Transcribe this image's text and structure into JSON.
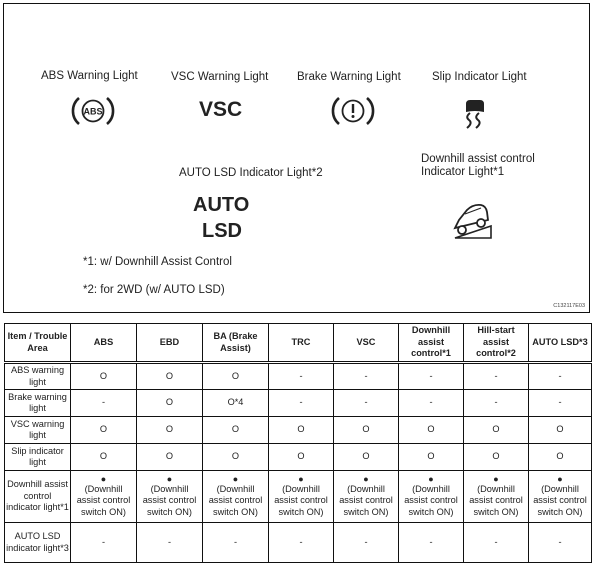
{
  "figure": {
    "labels": {
      "abs": "ABS Warning Light",
      "vsc": "VSC Warning Light",
      "brake": "Brake Warning Light",
      "slip": "Slip Indicator Light",
      "auto_lsd": "AUTO LSD Indicator Light*2",
      "downhill_line1": "Downhill assist control",
      "downhill_line2": "Indicator Light*1"
    },
    "icons": {
      "abs_text": "ABS",
      "vsc_text": "VSC",
      "auto_lsd_line1": "AUTO",
      "auto_lsd_line2": "LSD"
    },
    "footnotes": [
      "*1: w/ Downhill Assist Control",
      "*2: for 2WD (w/ AUTO LSD)"
    ],
    "code": "C132117E03"
  },
  "table": {
    "headers": [
      "Item / Trouble Area",
      "ABS",
      "EBD",
      "BA (Brake Assist)",
      "TRC",
      "VSC",
      "Downhill assist control*1",
      "Hill-start assist control*2",
      "AUTO LSD*3"
    ],
    "rows": [
      {
        "item": "ABS warning light",
        "cells": [
          "O",
          "O",
          "O",
          "-",
          "-",
          "-",
          "-",
          "-"
        ]
      },
      {
        "item": "Brake warning light",
        "cells": [
          "-",
          "O",
          "O*4",
          "-",
          "-",
          "-",
          "-",
          "-"
        ]
      },
      {
        "item": "VSC warning light",
        "cells": [
          "O",
          "O",
          "O",
          "O",
          "O",
          "O",
          "O",
          "O"
        ]
      },
      {
        "item": "Slip indicator light",
        "cells": [
          "O",
          "O",
          "O",
          "O",
          "O",
          "O",
          "O",
          "O"
        ]
      },
      {
        "item": "Downhill assist control indicator light*1",
        "dot": "●",
        "cells": [
          "(Downhill assist control switch ON)",
          "(Downhill assist control switch ON)",
          "(Downhill assist control switch ON)",
          "(Downhill assist control switch ON)",
          "(Downhill assist control switch ON)",
          "(Downhill assist control switch ON)",
          "(Downhill assist control switch ON)",
          "(Downhill assist control switch ON)"
        ]
      },
      {
        "item": "AUTO LSD indicator light*3",
        "cells": [
          "-",
          "-",
          "-",
          "-",
          "-",
          "-",
          "-",
          "-"
        ]
      }
    ]
  }
}
